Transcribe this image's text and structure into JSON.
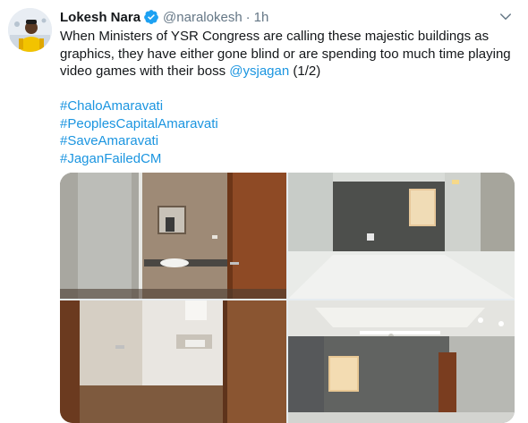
{
  "tweet": {
    "author_name": "Lokesh Nara",
    "handle": "@naralokesh",
    "separator": "·",
    "time": "1h",
    "text_main": "When Ministers of YSR Congress are calling these majestic buildings as graphics, they have either gone blind or are spending too much time playing video games with their boss ",
    "mention": "@ysjagan",
    "text_suffix": " (1/2)",
    "hashtags": [
      "#ChaloAmaravati",
      "#PeoplesCapitalAmaravati",
      "#SaveAmaravati",
      "#JaganFailedCM"
    ],
    "verified": true,
    "icons": {
      "verified": "verified-badge-icon",
      "more": "chevron-down-icon"
    },
    "photos": [
      "bathroom-with-glass-shower-and-sink",
      "empty-room-with-dark-accent-wall",
      "bathroom-doorway-view",
      "room-with-false-ceiling-and-window"
    ]
  },
  "colors": {
    "link": "#1b95e0",
    "verified": "#1da1f2",
    "secondary_text": "#657786",
    "primary_text": "#14171a"
  }
}
